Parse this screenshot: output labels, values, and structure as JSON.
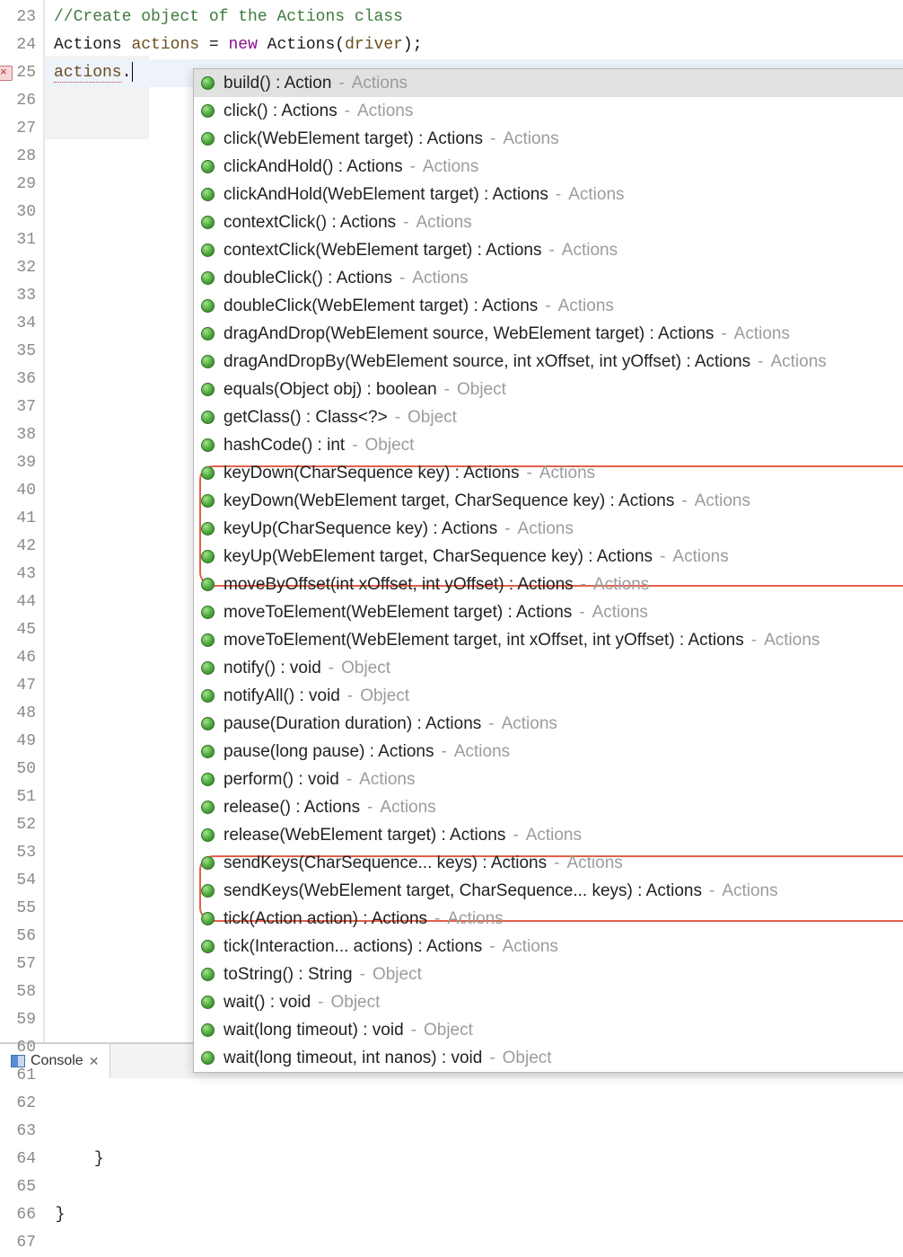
{
  "lines": {
    "start": 23,
    "end": 67
  },
  "error_line": 25,
  "code": {
    "l23_comment": "//Create object of the Actions class",
    "l24_type1": "Actions",
    "l24_var": "actions",
    "l24_eq": " = ",
    "l24_new": "new",
    "l24_type2": " Actions",
    "l24_paren_open": "(",
    "l24_param": "driver",
    "l24_paren_close": ");",
    "l25_var": "actions",
    "l25_dot": ".",
    "l64_brace": "}",
    "l66_brace": "}"
  },
  "popup": [
    {
      "sig": "build() : Action",
      "src": "Actions",
      "selected": true
    },
    {
      "sig": "click() : Actions",
      "src": "Actions"
    },
    {
      "sig": "click(WebElement target) : Actions",
      "src": "Actions"
    },
    {
      "sig": "clickAndHold() : Actions",
      "src": "Actions"
    },
    {
      "sig": "clickAndHold(WebElement target) : Actions",
      "src": "Actions"
    },
    {
      "sig": "contextClick() : Actions",
      "src": "Actions"
    },
    {
      "sig": "contextClick(WebElement target) : Actions",
      "src": "Actions"
    },
    {
      "sig": "doubleClick() : Actions",
      "src": "Actions"
    },
    {
      "sig": "doubleClick(WebElement target) : Actions",
      "src": "Actions"
    },
    {
      "sig": "dragAndDrop(WebElement source, WebElement target) : Actions",
      "src": "Actions"
    },
    {
      "sig": "dragAndDropBy(WebElement source, int xOffset, int yOffset) : Actions",
      "src": "Actions"
    },
    {
      "sig": "equals(Object obj) : boolean",
      "src": "Object"
    },
    {
      "sig": "getClass() : Class<?>",
      "src": "Object"
    },
    {
      "sig": "hashCode() : int",
      "src": "Object"
    },
    {
      "sig": "keyDown(CharSequence key) : Actions",
      "src": "Actions"
    },
    {
      "sig": "keyDown(WebElement target, CharSequence key) : Actions",
      "src": "Actions"
    },
    {
      "sig": "keyUp(CharSequence key) : Actions",
      "src": "Actions"
    },
    {
      "sig": "keyUp(WebElement target, CharSequence key) : Actions",
      "src": "Actions"
    },
    {
      "sig": "moveByOffset(int xOffset, int yOffset) : Actions",
      "src": "Actions"
    },
    {
      "sig": "moveToElement(WebElement target) : Actions",
      "src": "Actions"
    },
    {
      "sig": "moveToElement(WebElement target, int xOffset, int yOffset) : Actions",
      "src": "Actions"
    },
    {
      "sig": "notify() : void",
      "src": "Object"
    },
    {
      "sig": "notifyAll() : void",
      "src": "Object"
    },
    {
      "sig": "pause(Duration duration) : Actions",
      "src": "Actions"
    },
    {
      "sig": "pause(long pause) : Actions",
      "src": "Actions"
    },
    {
      "sig": "perform() : void",
      "src": "Actions"
    },
    {
      "sig": "release() : Actions",
      "src": "Actions"
    },
    {
      "sig": "release(WebElement target) : Actions",
      "src": "Actions"
    },
    {
      "sig": "sendKeys(CharSequence... keys) : Actions",
      "src": "Actions"
    },
    {
      "sig": "sendKeys(WebElement target, CharSequence... keys) : Actions",
      "src": "Actions"
    },
    {
      "sig": "tick(Action action) : Actions",
      "src": "Actions"
    },
    {
      "sig": "tick(Interaction... actions) : Actions",
      "src": "Actions"
    },
    {
      "sig": "toString() : String",
      "src": "Object"
    },
    {
      "sig": "wait() : void",
      "src": "Object"
    },
    {
      "sig": "wait(long timeout) : void",
      "src": "Object"
    },
    {
      "sig": "wait(long timeout, int nanos) : void",
      "src": "Object"
    }
  ],
  "bottom": {
    "console_label": "Console",
    "close": "✕"
  },
  "dash": "-"
}
